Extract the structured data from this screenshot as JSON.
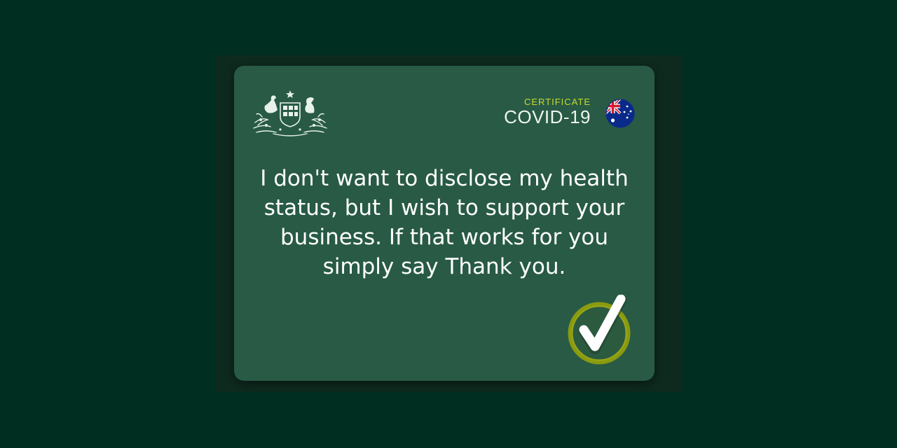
{
  "header": {
    "certificate_label": "CERTIFICATE",
    "certificate_title": "COVID-19"
  },
  "message": {
    "text": "I don't want to disclose my health status, but I wish to support your business. If that works for you simply say Thank you."
  },
  "icons": {
    "crest": "coat-of-arms-icon",
    "flag": "australian-flag-icon",
    "check": "checkmark-icon"
  },
  "colors": {
    "page_background": "#002f22",
    "card_background": "#285a45",
    "certificate_label": "#c9dc2e",
    "check_ring": "#c3c31a"
  }
}
